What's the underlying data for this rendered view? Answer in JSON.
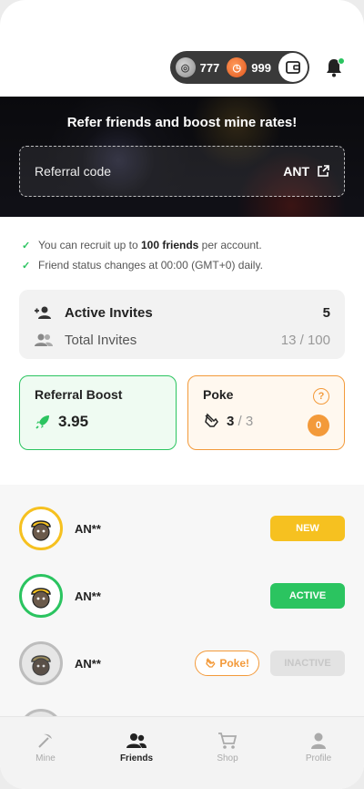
{
  "header": {
    "coin_silver_value": "777",
    "coin_orange_value": "999"
  },
  "hero": {
    "title": "Refer friends and boost mine rates!",
    "referral_label": "Referral code",
    "referral_code": "ANT"
  },
  "info": {
    "line1_prefix": "You can recruit up to ",
    "line1_bold": "100 friends",
    "line1_suffix": " per account.",
    "line2": "Friend status changes at 00:00 (GMT+0) daily."
  },
  "invites": {
    "active_label": "Active Invites",
    "active_value": "5",
    "total_label": "Total Invites",
    "total_value": "13 / 100"
  },
  "boost": {
    "title": "Referral Boost",
    "value": "3.95"
  },
  "poke": {
    "title": "Poke",
    "value": "3",
    "max": "/ 3",
    "count": "0",
    "help": "?"
  },
  "friends": [
    {
      "name": "AN**",
      "status": "NEW"
    },
    {
      "name": "AN**",
      "status": "ACTIVE"
    },
    {
      "name": "AN**",
      "status": "INACTIVE",
      "poke_label": "Poke!"
    }
  ],
  "nav": {
    "mine": "Mine",
    "friends": "Friends",
    "shop": "Shop",
    "profile": "Profile"
  },
  "colors": {
    "green": "#2bc460",
    "orange": "#f39a3a",
    "yellow": "#f6c120"
  }
}
